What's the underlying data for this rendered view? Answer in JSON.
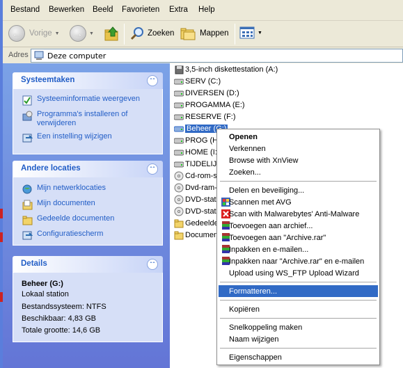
{
  "menubar": [
    "Bestand",
    "Bewerken",
    "Beeld",
    "Favorieten",
    "Extra",
    "Help"
  ],
  "toolbar": {
    "back": "Vorige",
    "search": "Zoeken",
    "folders": "Mappen"
  },
  "address": {
    "label": "Adres",
    "value": "Deze computer"
  },
  "taskpane": {
    "system_tasks": {
      "title": "Systeemtaken",
      "items": [
        "Systeeminformatie weergeven",
        "Programma's installeren of verwijderen",
        "Een instelling wijzigen"
      ]
    },
    "other_places": {
      "title": "Andere locaties",
      "items": [
        "Mijn netwerklocaties",
        "Mijn documenten",
        "Gedeelde documenten",
        "Configuratiescherm"
      ]
    },
    "details": {
      "title": "Details",
      "name": "Beheer (G:)",
      "type": "Lokaal station",
      "filesystem": "Bestandssysteem: NTFS",
      "free": "Beschikbaar: 4,83 GB",
      "total": "Totale grootte: 14,6 GB"
    }
  },
  "drives": [
    "3,5-inch diskettestation (A:)",
    "SERV (C:)",
    "DIVERSEN (D:)",
    "PROGAMMA (E:)",
    "RESERVE (F:)",
    "Beheer (G:)",
    "PROG (H:",
    "HOME (I:",
    "TIJDELIJK",
    "Cd-rom-s",
    "Dvd-ram-",
    "DVD-stati",
    "DVD-stati",
    "Gedeelde",
    "Documen"
  ],
  "context_menu": [
    "Openen",
    "Verkennen",
    "Browse with XnView",
    "Zoeken...",
    "Delen en beveiliging...",
    "Scannen met AVG",
    "Scan with Malwarebytes' Anti-Malware",
    "Toevoegen aan archief...",
    "Toevoegen aan \"Archive.rar\"",
    "Inpakken en e-mailen...",
    "Inpakken naar \"Archive.rar\" en e-mailen",
    "Upload using WS_FTP Upload Wizard",
    "Formatteren...",
    "Kopiëren",
    "Snelkoppeling maken",
    "Naam wijzigen",
    "Eigenschappen"
  ],
  "colors": {
    "taskpane_link": "#215dc6",
    "selection": "#316ac5",
    "taskpane_bg": "#6f8fde"
  }
}
